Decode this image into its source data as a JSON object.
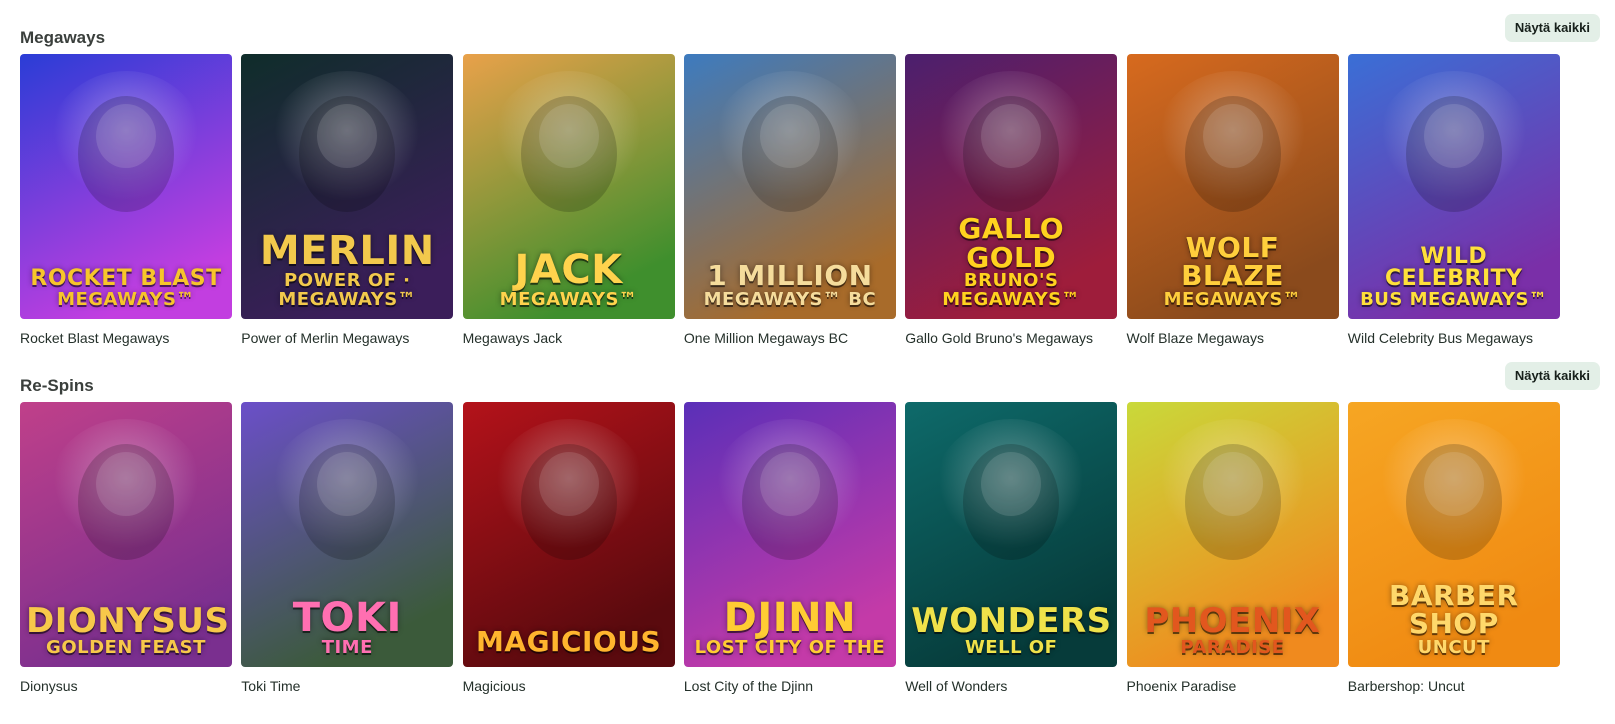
{
  "sections": [
    {
      "title": "Megaways",
      "view_all_label": "Näytä kaikki",
      "games": [
        {
          "name": "Rocket Blast Megaways",
          "logo_main": "ROCKET BLAST",
          "logo_sub": "MEGAWAYS™",
          "bg1": "#2a3dd6",
          "bg2": "#c23ee0",
          "logo_color": "#f7c52b",
          "art": "rocket-icon"
        },
        {
          "name": "Power of Merlin Megaways",
          "logo_main": "MERLIN",
          "logo_sub": "POWER OF · MEGAWAYS™",
          "bg1": "#0f2d2a",
          "bg2": "#3b1e5a",
          "logo_color": "#f2c94c",
          "art": "owl-icon"
        },
        {
          "name": "Megaways Jack",
          "logo_main": "JACK",
          "logo_sub": "MEGAWAYS™",
          "bg1": "#e9a14a",
          "bg2": "#3f8f2d",
          "logo_color": "#ffd34d",
          "art": "boy-icon"
        },
        {
          "name": "One Million Megaways BC",
          "logo_main": "1 MILLION",
          "logo_sub": "MEGAWAYS™ BC",
          "bg1": "#3d7bbf",
          "bg2": "#a86b2a",
          "logo_color": "#f5dc9c",
          "art": "mammoth-icon"
        },
        {
          "name": "Gallo Gold Bruno's Megaways",
          "logo_main": "GALLO GOLD",
          "logo_sub": "BRUNO'S MEGAWAYS™",
          "bg1": "#4b1f6e",
          "bg2": "#9e1d3b",
          "logo_color": "#ffd21f",
          "art": "rooster-icon"
        },
        {
          "name": "Wolf Blaze Megaways",
          "logo_main": "WOLF BLAZE",
          "logo_sub": "MEGAWAYS™",
          "bg1": "#d76a1e",
          "bg2": "#8a4a1c",
          "logo_color": "#ffcf3c",
          "art": "wolf-icon"
        },
        {
          "name": "Wild Celebrity Bus Megaways",
          "logo_main": "WILD CELEBRITY",
          "logo_sub": "BUS MEGAWAYS™",
          "bg1": "#3a6fd6",
          "bg2": "#7a2fa8",
          "logo_color": "#ffe03a",
          "art": "bus-icon"
        }
      ]
    },
    {
      "title": "Re-Spins",
      "view_all_label": "Näytä kaikki",
      "games": [
        {
          "name": "Dionysus",
          "logo_main": "DIONYSUS",
          "logo_sub": "GOLDEN FEAST",
          "bg1": "#c0408a",
          "bg2": "#7a2f8f",
          "logo_color": "#f7c84a",
          "art": "grapes-icon"
        },
        {
          "name": "Toki Time",
          "logo_main": "TOKI",
          "logo_sub": "TIME",
          "bg1": "#6b4fc9",
          "bg2": "#3b5a3a",
          "logo_color": "#ff6fb1",
          "art": "star-icon"
        },
        {
          "name": "Magicious",
          "logo_main": "MAGICIOUS",
          "logo_sub": "",
          "bg1": "#b4121a",
          "bg2": "#5a0a0e",
          "logo_color": "#ffb52e",
          "art": "magician-icon"
        },
        {
          "name": "Lost City of the Djinn",
          "logo_main": "DJINN",
          "logo_sub": "LOST CITY OF THE",
          "bg1": "#5a2fb8",
          "bg2": "#c43aa8",
          "logo_color": "#ffcc33",
          "art": "djinn-icon"
        },
        {
          "name": "Well of Wonders",
          "logo_main": "WONDERS",
          "logo_sub": "WELL OF",
          "bg1": "#0e6a6a",
          "bg2": "#063b3a",
          "logo_color": "#f0e24a",
          "art": "fairy-icon"
        },
        {
          "name": "Phoenix Paradise",
          "logo_main": "PHOENIX",
          "logo_sub": "PARADISE",
          "bg1": "#c9d93a",
          "bg2": "#f08a1e",
          "logo_color": "#e2571e",
          "art": "phoenix-icon"
        },
        {
          "name": "Barbershop: Uncut",
          "logo_main": "BARBER SHOP",
          "logo_sub": "UNCUT",
          "bg1": "#f6a623",
          "bg2": "#f08a12",
          "logo_color": "#ffd86b",
          "art": "barber-icon"
        }
      ]
    }
  ]
}
